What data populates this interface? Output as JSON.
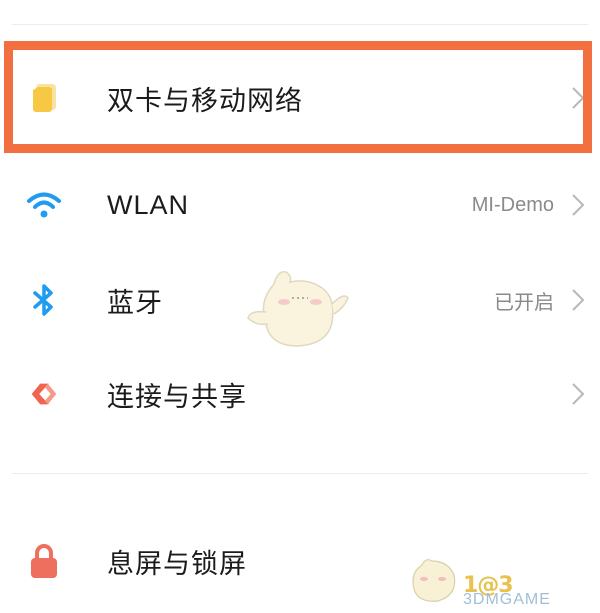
{
  "settings": {
    "items": [
      {
        "label": "双卡与移动网络",
        "value": "",
        "icon": "sim-card-icon",
        "color": "#f7c843"
      },
      {
        "label": "WLAN",
        "value": "MI-Demo",
        "icon": "wifi-icon",
        "color": "#1f9bf0"
      },
      {
        "label": "蓝牙",
        "value": "已开启",
        "icon": "bluetooth-icon",
        "color": "#1f9bf0"
      },
      {
        "label": "连接与共享",
        "value": "",
        "icon": "connection-share-icon",
        "color": "#ef6550"
      },
      {
        "label": "息屏与锁屏",
        "value": "",
        "icon": "lock-icon",
        "color": "#ee6f5e"
      }
    ]
  },
  "highlight_color": "#f2703f",
  "watermark": {
    "logo": "1@3",
    "site": "3DMGAME"
  }
}
